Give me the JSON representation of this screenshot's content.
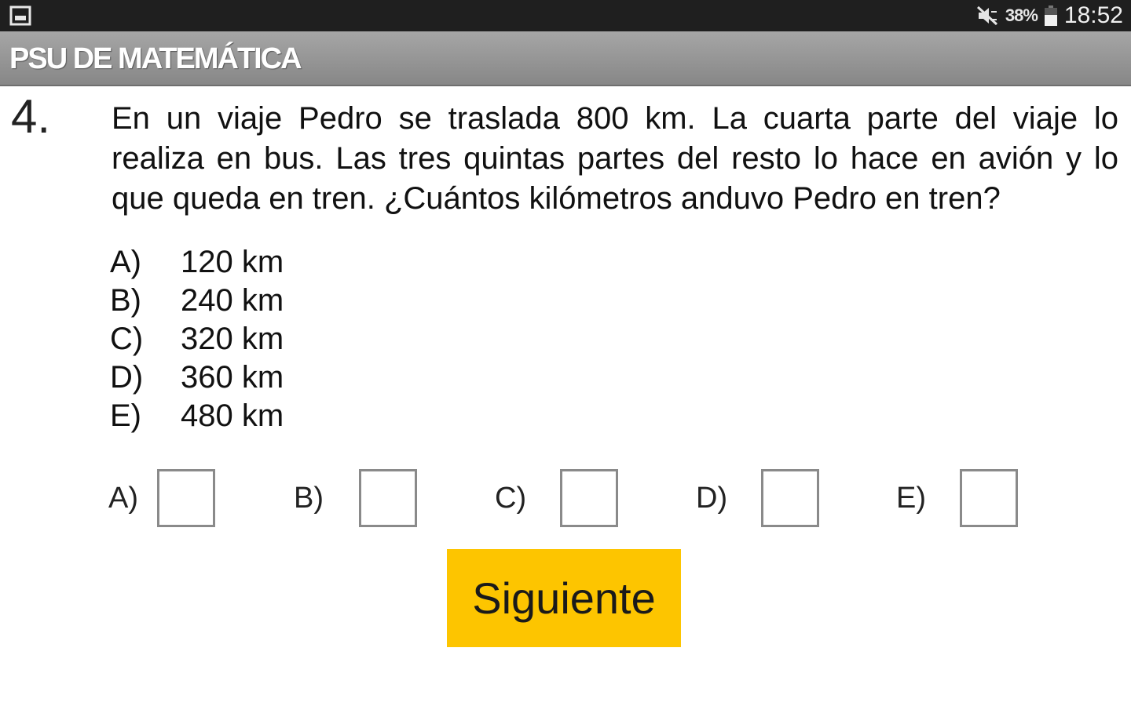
{
  "status_bar": {
    "left_icon": "image-notification-icon",
    "mute_icon": "mute-vibrate-icon",
    "battery_percent": "38%",
    "battery_icon": "battery-icon",
    "time": "18:52"
  },
  "app_bar": {
    "title": "PSU DE MATEMÁTICA"
  },
  "question": {
    "number": "4.",
    "text": "En un viaje Pedro se traslada 800 km. La cuarta parte del viaje lo realiza en bus. Las tres quintas partes del resto lo hace en avión y lo que queda en tren. ¿Cuántos kilómetros anduvo Pedro en tren?",
    "options": [
      {
        "letter": "A)",
        "value": "120 km"
      },
      {
        "letter": "B)",
        "value": "240 km"
      },
      {
        "letter": "C)",
        "value": "320 km"
      },
      {
        "letter": "D)",
        "value": "360 km"
      },
      {
        "letter": "E)",
        "value": "480 km"
      }
    ]
  },
  "answers": [
    {
      "label": "A)",
      "checked": false
    },
    {
      "label": "B)",
      "checked": false
    },
    {
      "label": "C)",
      "checked": false
    },
    {
      "label": "D)",
      "checked": false
    },
    {
      "label": "E)",
      "checked": false
    }
  ],
  "next_button": {
    "label": "Siguiente",
    "color": "#fdc500"
  }
}
